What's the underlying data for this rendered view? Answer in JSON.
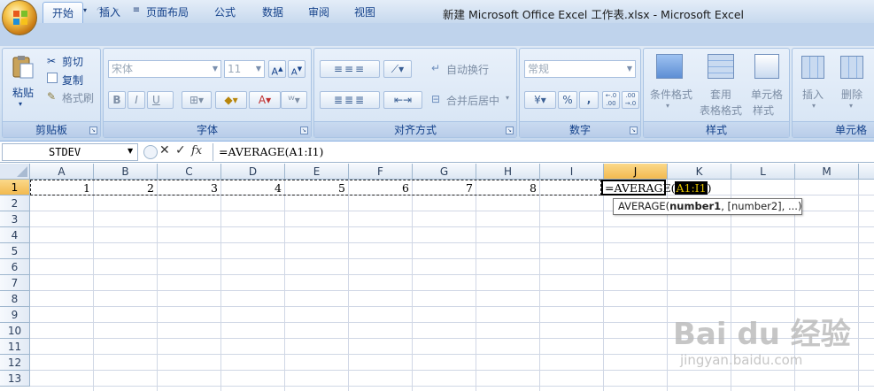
{
  "window": {
    "title": "新建 Microsoft Office Excel 工作表.xlsx - Microsoft Excel"
  },
  "ribbon": {
    "tabs": [
      "开始",
      "插入",
      "页面布局",
      "公式",
      "数据",
      "审阅",
      "视图"
    ],
    "active_tab": "开始",
    "clipboard": {
      "paste": "粘贴",
      "cut": "剪切",
      "copy": "复制",
      "format_painter": "格式刷",
      "label": "剪贴板"
    },
    "font": {
      "name": "宋体",
      "size": "11",
      "label": "字体",
      "bold": "B",
      "italic": "I",
      "underline": "U"
    },
    "alignment": {
      "wrap": "自动换行",
      "merge": "合并后居中",
      "label": "对齐方式"
    },
    "number": {
      "format": "常规",
      "percent": "%",
      "comma": ",",
      "label": "数字"
    },
    "styles": {
      "conditional": "条件格式",
      "table_format": [
        "套用",
        "表格格式"
      ],
      "cell_style": [
        "单元格",
        "样式"
      ],
      "label": "样式"
    },
    "cells": {
      "insert": "插入",
      "delete": "删除",
      "label": "单元格"
    }
  },
  "formula_bar": {
    "name_box": "STDEV",
    "fx": "fx",
    "formula": "=AVERAGE(A1:I1)"
  },
  "sheet": {
    "columns": [
      "A",
      "B",
      "C",
      "D",
      "E",
      "F",
      "G",
      "H",
      "I",
      "J",
      "K",
      "L",
      "M"
    ],
    "rows": [
      "1",
      "2",
      "3",
      "4",
      "5",
      "6",
      "7",
      "8",
      "9",
      "10",
      "11",
      "12",
      "13"
    ],
    "row1_values": [
      "1",
      "2",
      "3",
      "4",
      "5",
      "6",
      "7",
      "8"
    ],
    "edit_prefix": "=AVERAGE(",
    "edit_ref": "A1:I1",
    "edit_suffix": ")",
    "tooltip_func": "AVERAGE(",
    "tooltip_arg1": "number1",
    "tooltip_rest": ", [number2], ...)"
  },
  "watermark": {
    "main": "Bai du 经验",
    "sub": "jingyan.baidu.com"
  },
  "colors": {
    "active_header": "#f2b94f",
    "ribbon_bg": "#dfe9f5"
  }
}
